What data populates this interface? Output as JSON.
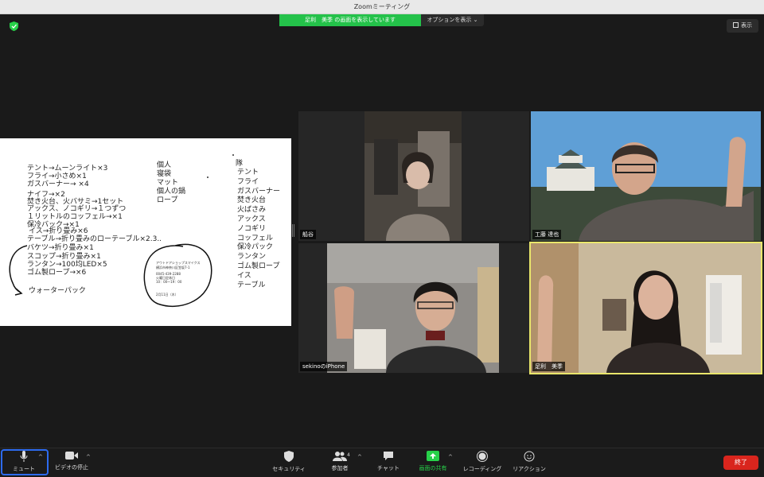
{
  "window": {
    "title": "Zoomミーティング"
  },
  "share_banner": {
    "text": "足利　美季 の画面を表示しています",
    "options_label": "オプションを表示"
  },
  "view_button": {
    "label": "表示"
  },
  "shared_screen": {
    "left_list": [
      "テント→ムーンライト×3",
      "フライ→小さめ×1",
      "ガスバーナー→ ×4",
      "ナイフ→×2",
      "焚き火台、火バサミ→1セット",
      "アックス、ノコギリ→１つずつ",
      "１リットルのコッフェル→×1",
      "保冷バック→×1",
      "イス→折り畳み×6",
      "テーブル→折り畳みのローテーブル×2.3..",
      "バケツ→折り畳み×1",
      "スコップ→折り畳み×1",
      "ランタン→100均LED×5",
      "ゴム製ロープ→×6",
      "ウォーターパック"
    ],
    "individual_header": "個人",
    "individual_list": [
      "寝袋",
      "マット",
      "個人の鍋",
      "ロープ"
    ],
    "team_header": "隊",
    "team_list": [
      "テント",
      "フライ",
      "ガスバーナー",
      "焚き火台",
      "火ばさみ",
      "アックス",
      "ノコギリ",
      "コッフェル",
      "保冷パック",
      "ランタン",
      "ゴム製ロープ",
      "イス",
      "テーブル"
    ],
    "memo": [
      "アウトドアショップスマイクス",
      "横浜市神奈川区笠坂7-1",
      "0045-439-2288",
      "火曜日定休日",
      "10：00～19：00",
      "2月11日（木）"
    ]
  },
  "participants": [
    {
      "name": "船谷"
    },
    {
      "name": "工藤 達也"
    },
    {
      "name": "sekinoのiPhone"
    },
    {
      "name": "足利　美季"
    }
  ],
  "toolbar": {
    "mute": "ミュート",
    "video": "ビデオの停止",
    "security": "セキュリティ",
    "participants": "参加者",
    "participants_count": "4",
    "chat": "チャット",
    "share": "画面の共有",
    "record": "レコーディング",
    "reactions": "リアクション",
    "end": "終了"
  },
  "colors": {
    "share_green": "#24c24a",
    "end_red": "#d9251d",
    "active_speaker": "#e9e66b",
    "mute_outline": "#2d6bf0"
  }
}
